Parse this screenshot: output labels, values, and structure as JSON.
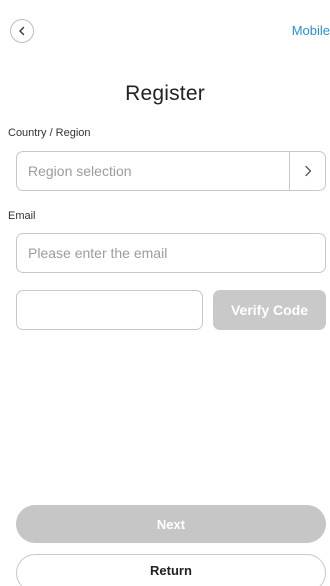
{
  "header": {
    "back_icon": "chevron-left-icon",
    "mobile_link": "Mobile"
  },
  "page": {
    "title": "Register"
  },
  "region": {
    "label": "Country / Region",
    "placeholder": "Region selection",
    "arrow_icon": "chevron-right-icon"
  },
  "email": {
    "label": "Email",
    "placeholder": "Please enter the email",
    "value": ""
  },
  "verify": {
    "code_value": "",
    "button_label": "Verify Code"
  },
  "actions": {
    "next_label": "Next",
    "return_label": "Return"
  },
  "colors": {
    "accent": "#2a8fd6",
    "disabled_button": "#c9c9c9",
    "border": "#c8c8c8",
    "placeholder": "#9c9c9c"
  }
}
